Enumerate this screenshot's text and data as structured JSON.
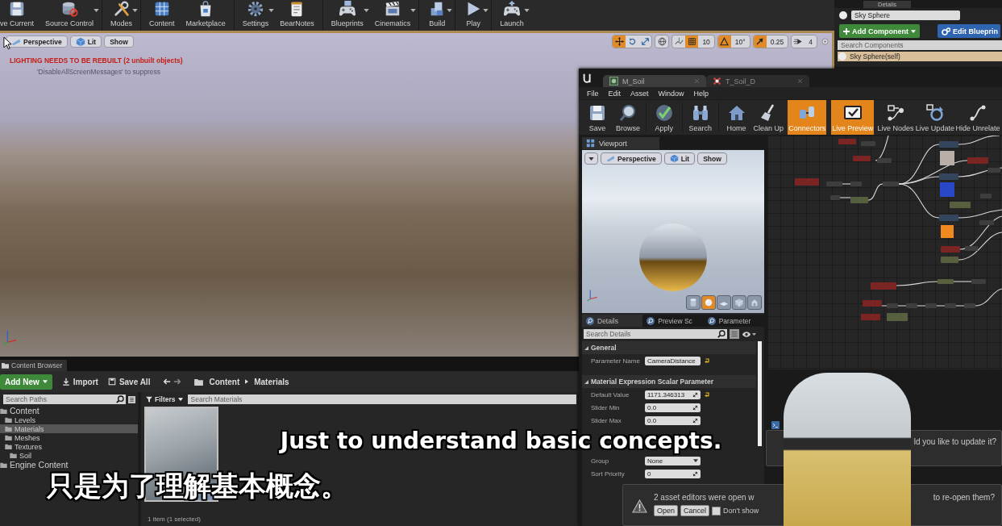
{
  "main_toolbar": {
    "buttons": [
      {
        "label": "ve Current",
        "dropdown": false
      },
      {
        "label": "Source Control",
        "dropdown": true
      },
      {
        "label": "Modes",
        "dropdown": true
      },
      {
        "label": "Content",
        "dropdown": false
      },
      {
        "label": "Marketplace",
        "dropdown": false
      },
      {
        "label": "Settings",
        "dropdown": true
      },
      {
        "label": "BearNotes",
        "dropdown": false
      },
      {
        "label": "Blueprints",
        "dropdown": true
      },
      {
        "label": "Cinematics",
        "dropdown": true
      },
      {
        "label": "Build",
        "dropdown": true
      },
      {
        "label": "Play",
        "dropdown": true
      },
      {
        "label": "Launch",
        "dropdown": true
      }
    ]
  },
  "details_panel": {
    "tab": "Details",
    "name_field": {
      "value": "Sky Sphere"
    },
    "add_component": "Add Component",
    "edit_blueprint": "Edit Blueprin",
    "search": {
      "placeholder": "Search Components"
    },
    "components": [
      {
        "label": "Sky Sphere(self)",
        "selected": true
      }
    ]
  },
  "level_viewport": {
    "view_buttons": [
      "Perspective",
      "Lit",
      "Show"
    ],
    "messages": [
      {
        "kind": "error",
        "text": "LIGHTING NEEDS TO BE REBUILT (2 unbuilt objects)"
      },
      {
        "kind": "hint",
        "text": "'DisableAllScreenMessages' to suppress"
      }
    ],
    "transform_modes": [
      {
        "selected": true
      },
      {
        "selected": false
      },
      {
        "selected": false
      }
    ],
    "snaps": [
      {
        "on": true,
        "value": "10"
      },
      {
        "on": true,
        "value": "10°"
      },
      {
        "on": true,
        "value": "0.25"
      }
    ],
    "camera_speed": "4"
  },
  "material_editor": {
    "tabs": [
      {
        "label": "M_Soil",
        "selected": true
      },
      {
        "label": "T_Soil_D",
        "selected": false
      }
    ],
    "menu": [
      "File",
      "Edit",
      "Asset",
      "Window",
      "Help"
    ],
    "toolbar": [
      {
        "label": "Save",
        "on": false
      },
      {
        "label": "Browse",
        "on": false
      },
      {
        "label": "Apply",
        "on": false
      },
      {
        "label": "Search",
        "on": false
      },
      {
        "label": "Home",
        "on": false
      },
      {
        "label": "Clean Up",
        "on": false
      },
      {
        "label": "Connectors",
        "on": true
      },
      {
        "label": "Live Preview",
        "on": true
      },
      {
        "label": "Live Nodes",
        "on": false
      },
      {
        "label": "Live Update",
        "on": false
      },
      {
        "label": "Hide Unrelate",
        "on": false
      }
    ],
    "viewport": {
      "tab": "Viewport",
      "view_buttons": [
        "Perspective",
        "Lit",
        "Show"
      ],
      "preview_shapes": [
        {
          "selected": false
        },
        {
          "selected": true
        },
        {
          "selected": false
        },
        {
          "selected": false
        },
        {
          "selected": false
        }
      ]
    },
    "details": {
      "tabs": [
        {
          "label": "Details",
          "selected": true
        },
        {
          "label": "Preview Sc",
          "selected": false
        },
        {
          "label": "Parameter",
          "selected": false
        }
      ],
      "search": {
        "placeholder": "Search Details"
      },
      "sections": [
        {
          "title": "General",
          "rows": [
            {
              "label": "Parameter Name",
              "value": "CameraDistance",
              "kind": "text",
              "reset": true
            }
          ]
        },
        {
          "title": "Material Expression Scalar Parameter",
          "rows": [
            {
              "label": "Default Value",
              "value": "1171.346313",
              "kind": "number",
              "reset": true
            },
            {
              "label": "Slider Min",
              "value": "0.0",
              "kind": "number",
              "reset": false
            },
            {
              "label": "Slider Max",
              "value": "0.0",
              "kind": "number",
              "reset": false
            }
          ]
        },
        {
          "rows": [
            {
              "label": "Group",
              "value": "None",
              "kind": "dropdown",
              "reset": false
            },
            {
              "label": "Sort Priority",
              "value": "0",
              "kind": "number",
              "reset": false
            }
          ]
        }
      ]
    }
  },
  "content_browser": {
    "tab": "Content Browser",
    "add_new": "Add New",
    "import": "Import",
    "save_all": "Save All",
    "path": [
      "Content",
      "Materials"
    ],
    "path_search": {
      "placeholder": "Search Paths"
    },
    "tree": [
      {
        "label": "Content",
        "selected": false,
        "children": [
          {
            "label": "Levels",
            "selected": false
          },
          {
            "label": "Materials",
            "selected": true
          },
          {
            "label": "Meshes",
            "selected": false
          },
          {
            "label": "Textures",
            "selected": false,
            "children": [
              {
                "label": "Soil",
                "selected": false
              }
            ]
          }
        ]
      },
      {
        "label": "Engine Content",
        "selected": false
      }
    ],
    "filters": "Filters",
    "asset_search": {
      "placeholder": "Search Materials"
    },
    "assets": [
      {
        "selected": true
      }
    ],
    "status": "1 item (1 selected)"
  },
  "notifications": [
    {
      "text": "ld you like to update it?"
    },
    {
      "text": "2 asset editors were open w",
      "text_end": "to re-open them?",
      "buttons": [
        "Open",
        "Cancel"
      ],
      "checkbox": {
        "label": "Don't show",
        "checked": false
      }
    }
  ],
  "subtitles": [
    "Just to understand basic concepts.",
    "只是为了理解基本概念。"
  ]
}
